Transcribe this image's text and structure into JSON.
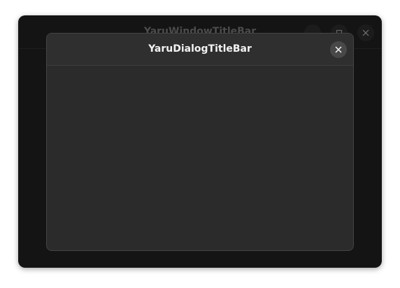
{
  "window": {
    "title": "YaruWindowTitleBar",
    "buttons": [
      "minimize",
      "maximize",
      "close"
    ]
  },
  "dialog": {
    "title": "YaruDialogTitleBar",
    "close_icon": "close-icon"
  }
}
